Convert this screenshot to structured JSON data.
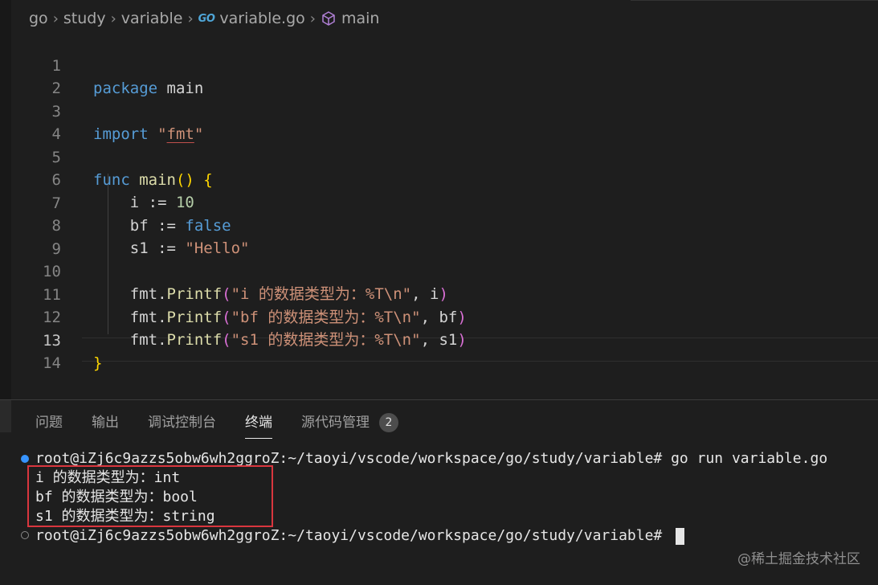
{
  "breadcrumb": {
    "items": [
      "go",
      "study",
      "variable"
    ],
    "file_badge": "GO",
    "file": "variable.go",
    "symbol": "main"
  },
  "editor": {
    "line_numbers": [
      "1",
      "2",
      "3",
      "4",
      "5",
      "6",
      "7",
      "8",
      "9",
      "10",
      "11",
      "12",
      "13",
      "14"
    ],
    "active_line": "13",
    "tokens": {
      "l1_kw": "package",
      "l1_id": " main",
      "l3_kw": "import",
      "l3_q1": " \"",
      "l3_pkg": "fmt",
      "l3_q2": "\"",
      "l5_kw": "func",
      "l5_fn": " main",
      "l5_paren": "()",
      "l5_brace": " {",
      "l6_id": "    i := ",
      "l6_num": "10",
      "l7_id": "    bf := ",
      "l7_kw": "false",
      "l8_id": "    s1 := ",
      "l8_str": "\"Hello\"",
      "l10_pre": "    fmt.",
      "l10_fn": "Printf",
      "l10_p1": "(",
      "l10_str": "\"i 的数据类型为：%T\\n\"",
      "l10_rest": ", i",
      "l10_p2": ")",
      "l11_pre": "    fmt.",
      "l11_fn": "Printf",
      "l11_p1": "(",
      "l11_str": "\"bf 的数据类型为：%T\\n\"",
      "l11_rest": ", bf",
      "l11_p2": ")",
      "l12_pre": "    fmt.",
      "l12_fn": "Printf",
      "l12_p1": "(",
      "l12_str": "\"s1 的数据类型为：%T\\n\"",
      "l12_rest": ", s1",
      "l12_p2": ")",
      "l13_brace": "}"
    }
  },
  "panel": {
    "tabs": [
      "问题",
      "输出",
      "调试控制台",
      "终端",
      "源代码管理"
    ],
    "active_tab": "终端",
    "scm_badge": "2"
  },
  "terminal": {
    "prompt_line": "root@iZj6c9azzs5obw6wh2ggroZ:~/taoyi/vscode/workspace/go/study/variable# go run variable.go",
    "output": [
      "i 的数据类型为：int",
      "bf 的数据类型为：bool",
      "s1 的数据类型为：string"
    ],
    "last_prompt": "root@iZj6c9azzs5obw6wh2ggroZ:~/taoyi/vscode/workspace/go/study/variable# "
  },
  "watermark": "@稀土掘金技术社区",
  "colors": {
    "keyword": "#569cd6",
    "function": "#dcdcaa",
    "string": "#ce9178",
    "number": "#b5cea8",
    "brace": "#ffd700",
    "paren": "#da70d6",
    "highlight_box": "#d9363e"
  }
}
